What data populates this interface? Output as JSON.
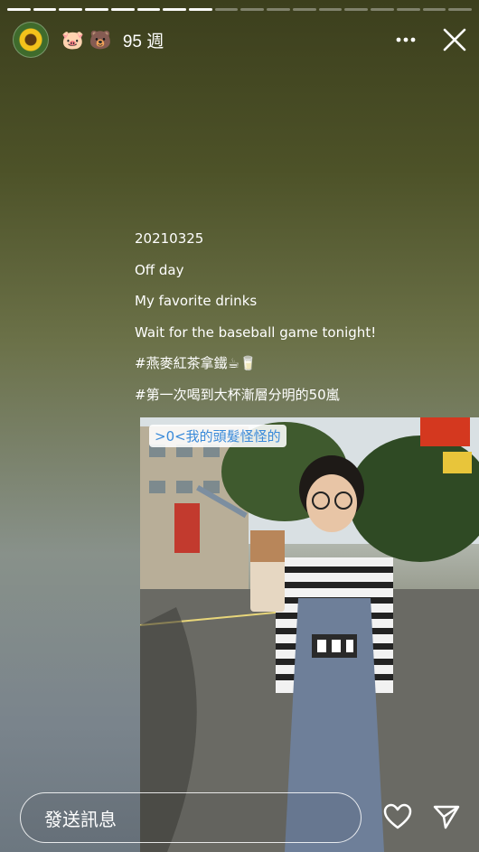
{
  "progress": {
    "segments": [
      {
        "fill": 1.0
      },
      {
        "fill": 1.0
      },
      {
        "fill": 1.0
      },
      {
        "fill": 1.0
      },
      {
        "fill": 1.0
      },
      {
        "fill": 1.0
      },
      {
        "fill": 1.0
      },
      {
        "fill": 1.0
      },
      {
        "fill": 0.0
      },
      {
        "fill": 0.0
      },
      {
        "fill": 0.0
      },
      {
        "fill": 0.0
      },
      {
        "fill": 0.0
      },
      {
        "fill": 0.0
      },
      {
        "fill": 0.0
      },
      {
        "fill": 0.0
      },
      {
        "fill": 0.0
      },
      {
        "fill": 0.0
      }
    ]
  },
  "header": {
    "avatar_icon": "sunflower-avatar",
    "emoji_1": "🐷",
    "emoji_2": "🐻",
    "time": "95 週",
    "more_icon": "more-horizontal-icon",
    "close_icon": "close-icon"
  },
  "caption": {
    "lines": [
      "20210325",
      "Off day",
      "My favorite drinks",
      "Wait for the baseball game tonight!",
      "#燕麥紅茶拿鐵☕🥛",
      "#第一次喝到大杯漸層分明的50嵐"
    ]
  },
  "photo": {
    "caption": ">0<我的頭髮怪怪的"
  },
  "footer": {
    "reply_placeholder": "發送訊息",
    "like_icon": "heart-icon",
    "share_icon": "send-icon"
  }
}
